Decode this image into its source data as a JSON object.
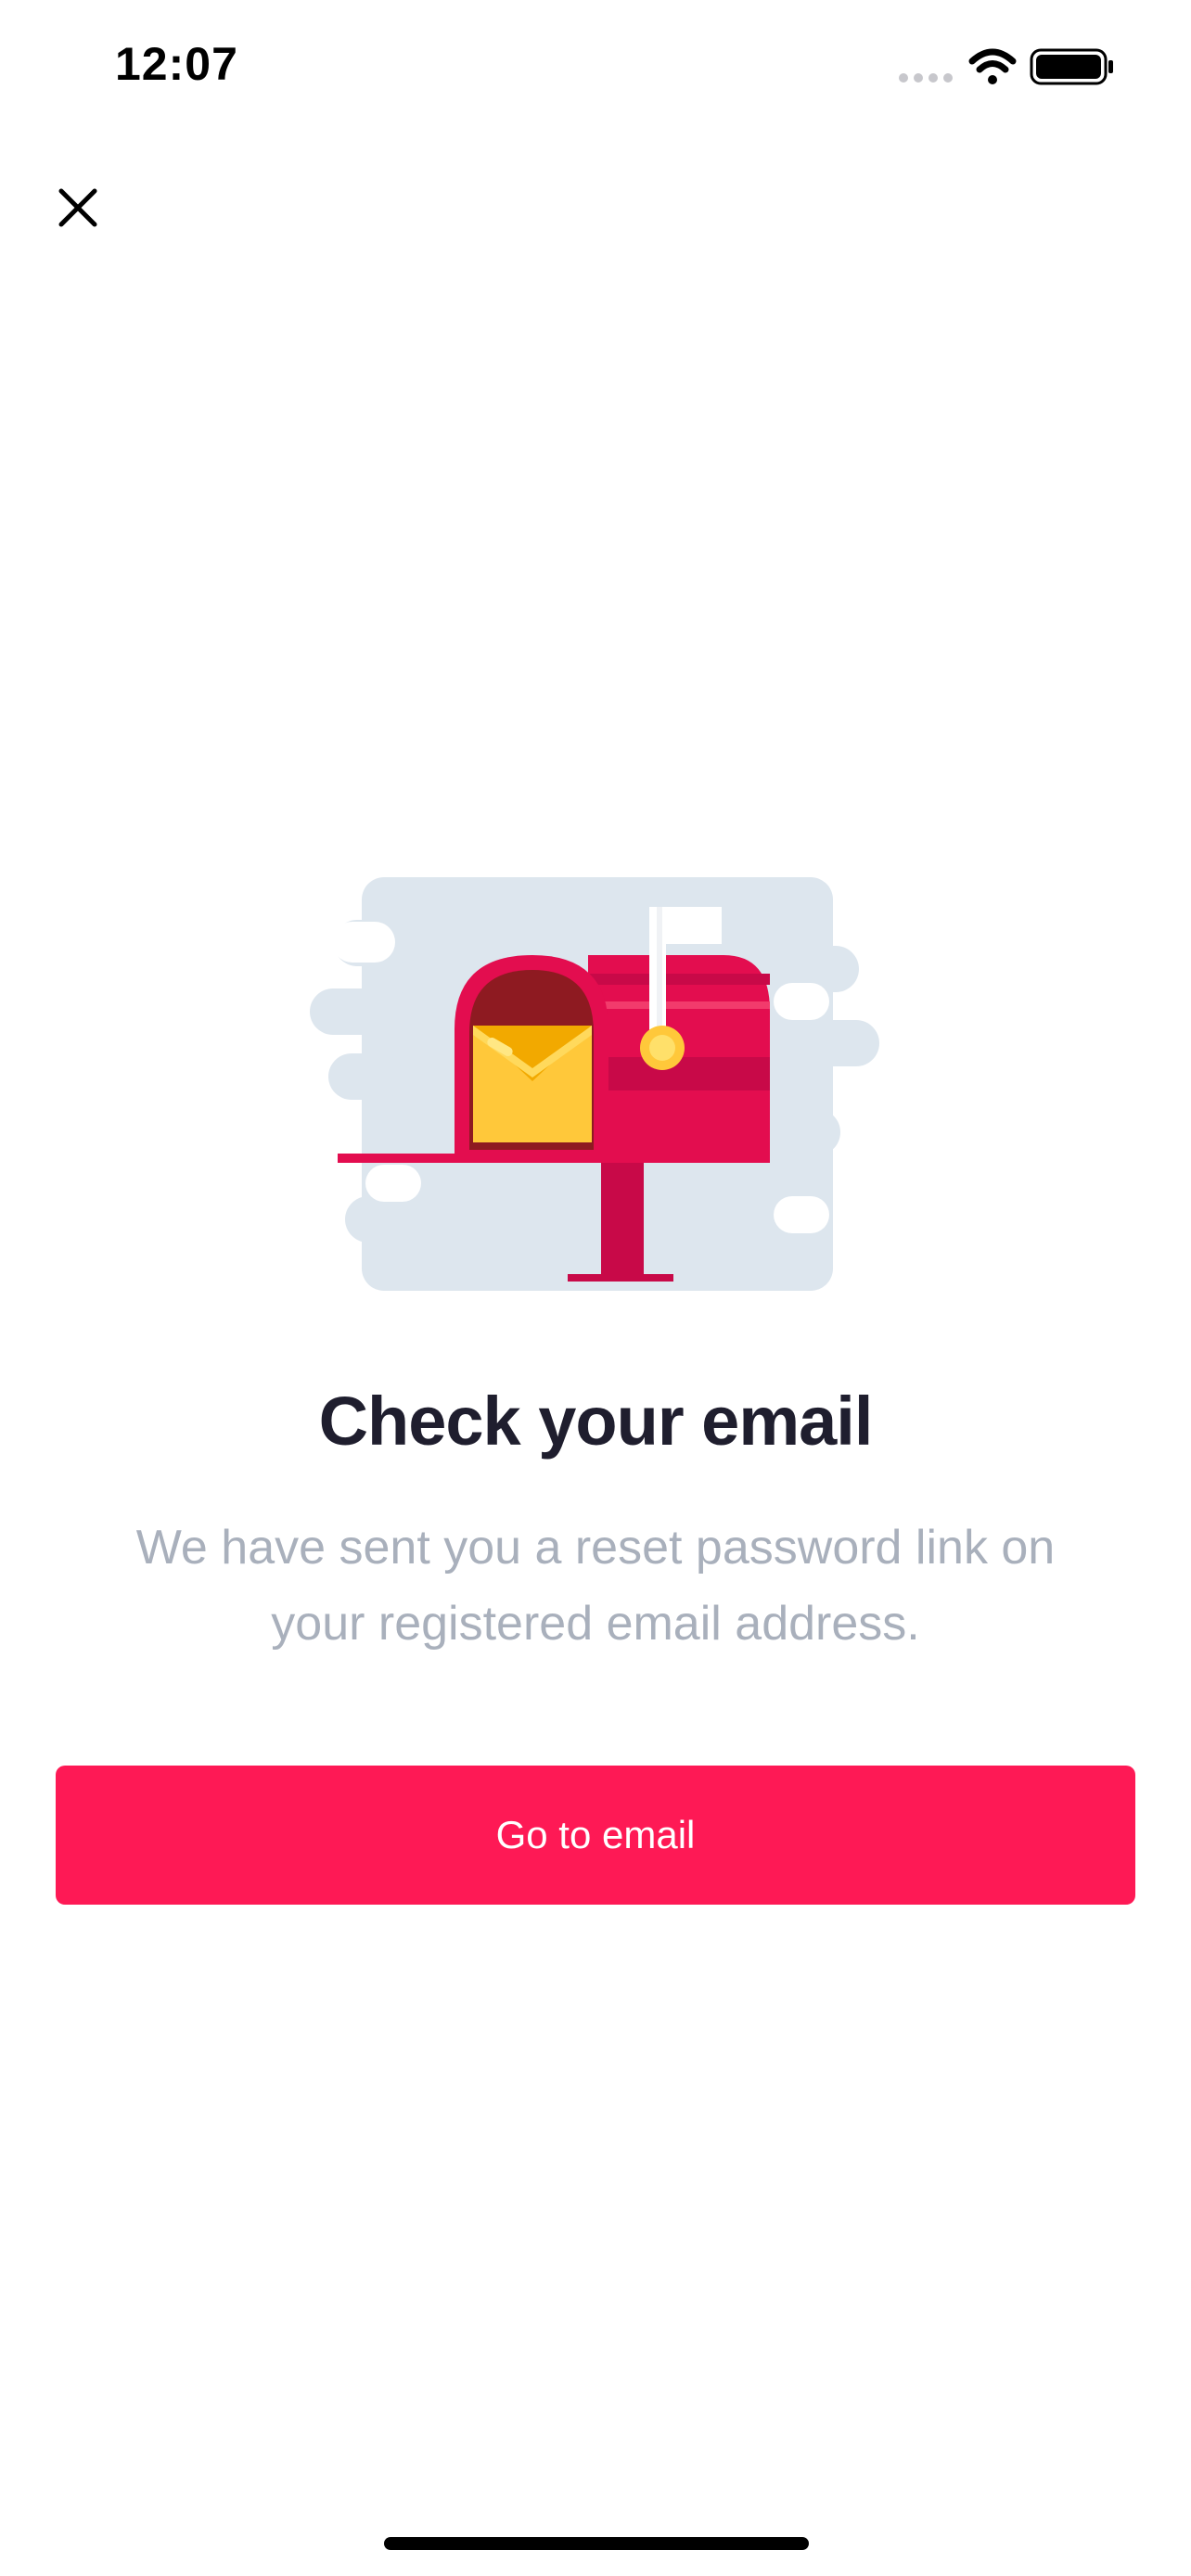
{
  "status_bar": {
    "time": "12:07",
    "signal_icon": "signal-dots-icon",
    "wifi_icon": "wifi-icon",
    "battery_icon": "battery-icon"
  },
  "header": {
    "close_icon": "close-icon"
  },
  "illustration": {
    "name": "mailbox-with-envelope",
    "colors": {
      "cloud": "#dde6ee",
      "mailbox": "#e30d4f",
      "mailbox_dark": "#c80948",
      "mailbox_inner": "#8e1a21",
      "envelope": "#ffd142",
      "flag": "#ffffff"
    }
  },
  "main": {
    "title": "Check your email",
    "subtitle_line1": "We have sent you a reset password link on",
    "subtitle_line2": "your registered email address.",
    "button_label": "Go to email"
  },
  "colors": {
    "accent": "#fe1955",
    "title": "#1f1e2e",
    "subtitle": "#a9b0bc"
  }
}
